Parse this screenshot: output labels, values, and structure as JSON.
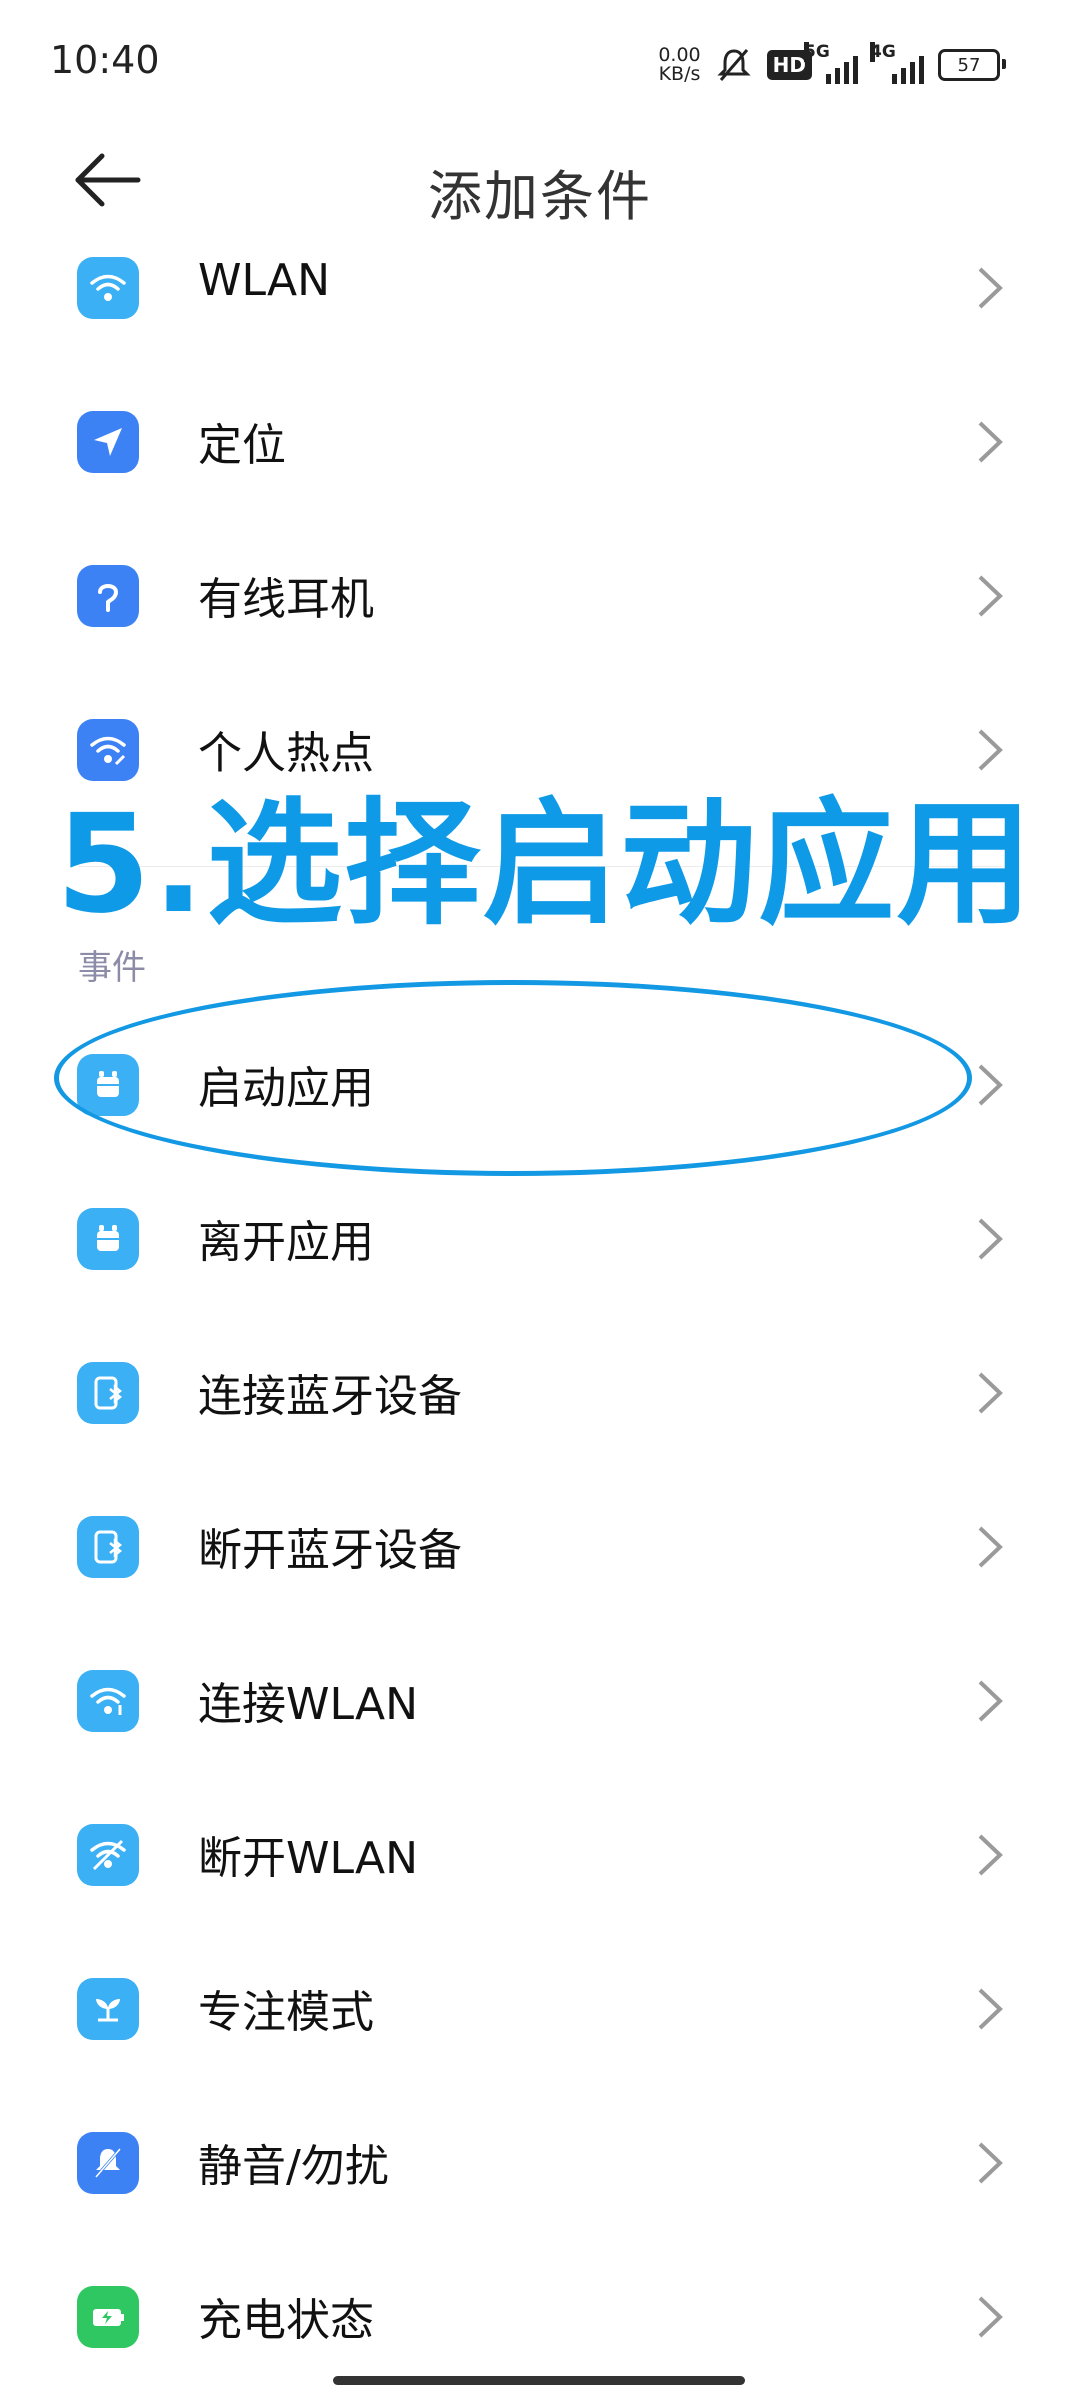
{
  "status": {
    "time": "10:40",
    "speed_top": "0.00",
    "speed_bottom": "KB/s",
    "hd": "HD",
    "net1": "5G",
    "net2": "4G",
    "battery": "57"
  },
  "header": {
    "title": "添加条件"
  },
  "items_top": [
    {
      "label": "WLAN",
      "icon": "wifi-icon",
      "color": "#3cb0f5"
    },
    {
      "label": "定位",
      "icon": "location-arrow-icon",
      "color": "#3d82f5"
    },
    {
      "label": "有线耳机",
      "icon": "wired-earphone-icon",
      "color": "#3d82f5"
    },
    {
      "label": "个人热点",
      "icon": "hotspot-icon",
      "color": "#3d82f5"
    }
  ],
  "section": {
    "events_label": "事件"
  },
  "items_events": [
    {
      "label": "启动应用",
      "icon": "app-launch-icon",
      "color": "#3cb0f5"
    },
    {
      "label": "离开应用",
      "icon": "app-leave-icon",
      "color": "#3cb0f5"
    },
    {
      "label": "连接蓝牙设备",
      "icon": "bluetooth-device-icon",
      "color": "#3cb0f5"
    },
    {
      "label": "断开蓝牙设备",
      "icon": "bluetooth-disconnect-icon",
      "color": "#3cb0f5"
    },
    {
      "label": "连接WLAN",
      "icon": "wifi-connect-icon",
      "color": "#3cb0f5"
    },
    {
      "label": "断开WLAN",
      "icon": "wifi-disconnect-icon",
      "color": "#3cb0f5"
    },
    {
      "label": "专注模式",
      "icon": "focus-sprout-icon",
      "color": "#3cb0f5"
    },
    {
      "label": "静音/勿扰",
      "icon": "mute-bell-icon",
      "color": "#3d82f5"
    },
    {
      "label": "充电状态",
      "icon": "charging-battery-icon",
      "color": "#2fc761"
    }
  ],
  "overlay": {
    "instruction": "5.选择启动应用",
    "color": "#0f9ae8"
  }
}
